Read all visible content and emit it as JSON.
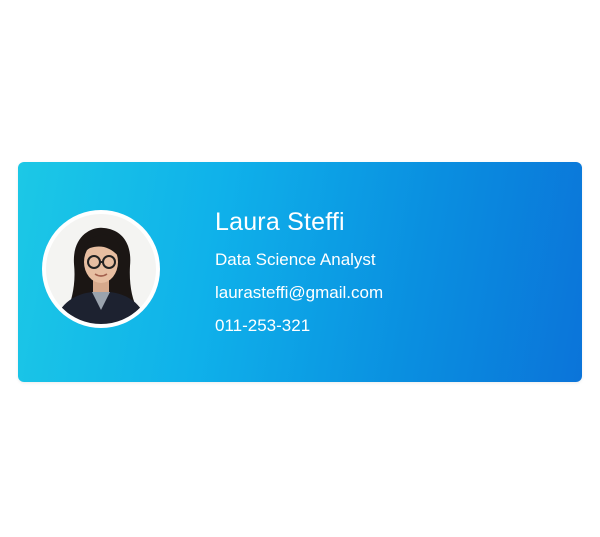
{
  "card": {
    "name": "Laura Steffi",
    "title": "Data Science Analyst",
    "email": "laurasteffi@gmail.com",
    "phone": "011-253-321"
  },
  "colors": {
    "gradient_start": "#1cc8e6",
    "gradient_end": "#0b74d9",
    "text": "#ffffff"
  },
  "icons": {
    "avatar": "profile-photo"
  }
}
